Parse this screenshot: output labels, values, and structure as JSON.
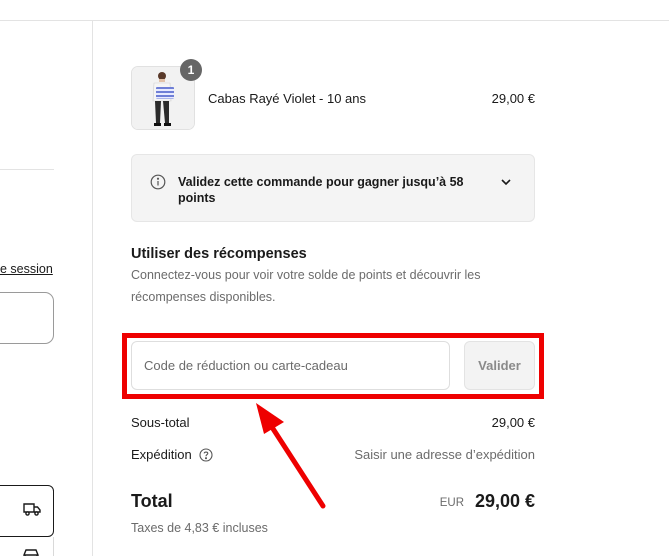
{
  "left_panel": {
    "login_link": "e session",
    "icon_delivery": "delivery-truck-icon",
    "icon_pickup": "store-icon"
  },
  "cart": {
    "item": {
      "name": "Cabas Rayé Violet - 10 ans",
      "price": "29,00 €",
      "quantity": "1"
    }
  },
  "points_banner": {
    "message": "Validez cette commande pour gagner jusqu’à 58 points",
    "icons": [
      "info-icon",
      "chevron-down-icon"
    ]
  },
  "rewards": {
    "title": "Utiliser des récompenses",
    "description": "Connectez-vous pour voir votre solde de points et découvrir les récompenses disponibles."
  },
  "discount": {
    "placeholder": "Code de réduction ou carte-cadeau",
    "value": "",
    "button_label": "Valider"
  },
  "summary": {
    "subtotal_label": "Sous-total",
    "subtotal_value": "29,00 €",
    "shipping_label": "Expédition",
    "shipping_value": "Saisir une adresse d’expédition",
    "total_label": "Total",
    "currency": "EUR",
    "total_value": "29,00 €",
    "taxes": "Taxes de 4,83 € incluses"
  },
  "annotation": {
    "highlight_color": "#ee0000"
  }
}
